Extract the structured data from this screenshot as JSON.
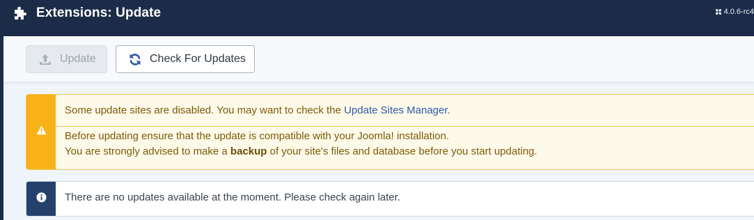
{
  "header": {
    "title": "Extensions: Update",
    "version": "4.0.6-rc4",
    "icon": "puzzle-piece-icon"
  },
  "toolbar": {
    "update_label": "Update",
    "check_label": "Check For Updates"
  },
  "alerts": {
    "warning": {
      "line1_text": "Some update sites are disabled. You may want to check the ",
      "line1_link": "Update Sites Manager",
      "line1_end": ".",
      "line2": "Before updating ensure that the update is compatible with your Joomla! installation.",
      "line3_pre": "You are strongly advised to make a ",
      "line3_bold": "backup",
      "line3_post": " of your site's files and database before you start updating."
    },
    "info": {
      "text": "There are no updates available at the moment. Please check again later."
    }
  },
  "colors": {
    "header_bg": "#1c2c48",
    "warning_accent": "#f9b117",
    "info_accent": "#23416b",
    "link": "#2e58a6"
  }
}
